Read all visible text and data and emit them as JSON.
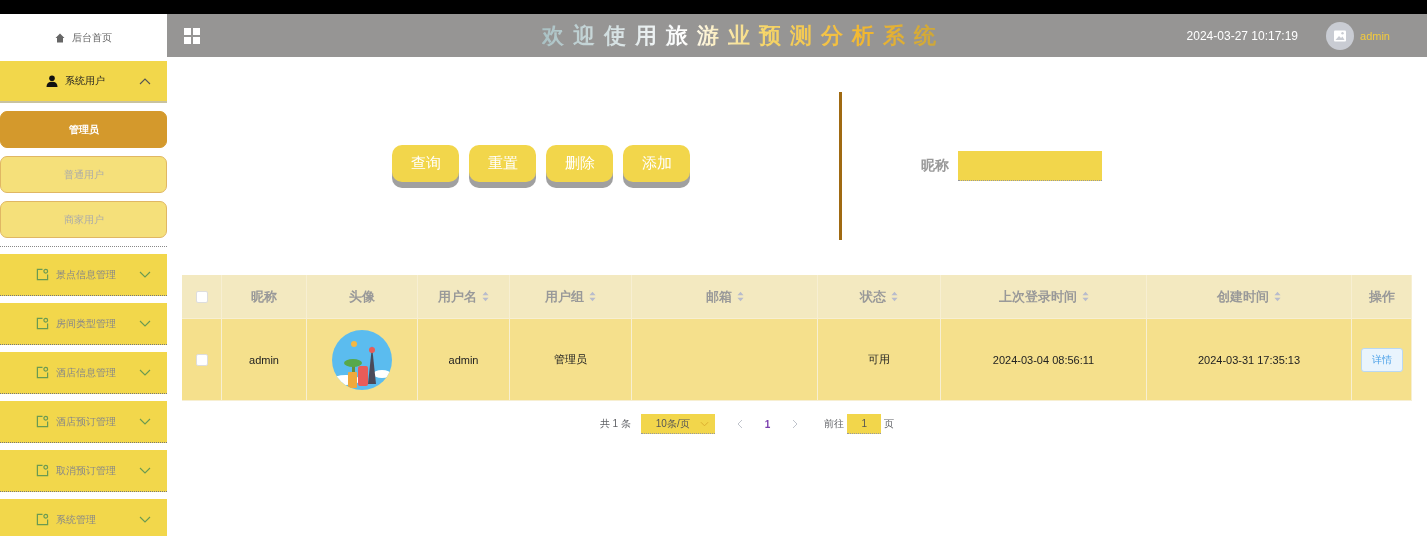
{
  "sidebar": {
    "home": {
      "label": "后台首页"
    },
    "groups": [
      {
        "label": "系统用户",
        "kind": "user",
        "expanded": true,
        "children": [
          {
            "label": "管理员",
            "selected": true
          },
          {
            "label": "普通用户",
            "selected": false
          },
          {
            "label": "商家用户",
            "selected": false
          }
        ]
      },
      {
        "label": "景点信息管理",
        "kind": "page",
        "expanded": false
      },
      {
        "label": "房间类型管理",
        "kind": "page",
        "expanded": false
      },
      {
        "label": "酒店信息管理",
        "kind": "page",
        "expanded": false
      },
      {
        "label": "酒店预订管理",
        "kind": "page",
        "expanded": false
      },
      {
        "label": "取消预订管理",
        "kind": "page",
        "expanded": false
      },
      {
        "label": "系统管理",
        "kind": "page",
        "expanded": false
      }
    ]
  },
  "header": {
    "title": "欢迎使用旅游业预测分析系统",
    "datetime": "2024-03-27 10:17:19",
    "user": "admin"
  },
  "search": {
    "buttons": [
      "查询",
      "重置",
      "删除",
      "添加"
    ],
    "field": {
      "label": "昵称"
    }
  },
  "table": {
    "select_all": {
      "checked": false
    },
    "columns": [
      {
        "label": "昵称",
        "sortable": false
      },
      {
        "label": "头像",
        "sortable": false
      },
      {
        "label": "用户名",
        "sortable": true
      },
      {
        "label": "用户组",
        "sortable": true
      },
      {
        "label": "邮箱",
        "sortable": true
      },
      {
        "label": "状态",
        "sortable": true
      },
      {
        "label": "上次登录时间",
        "sortable": true
      },
      {
        "label": "创建时间",
        "sortable": true
      },
      {
        "label": "操作",
        "sortable": false
      }
    ],
    "rows": [
      {
        "checked": false,
        "cells": [
          "admin",
          {
            "kind": "picture"
          },
          "admin",
          "管理员",
          null,
          "可用",
          "2024-03-04 08:56:11",
          "2024-03-31 17:35:13"
        ],
        "action": "详情"
      }
    ]
  },
  "pagination": {
    "total": "共 1 条",
    "page_size": "10条/页",
    "pages": [
      {
        "label": "1",
        "selected": true
      }
    ],
    "goto_label": "前往",
    "goto_value": "1",
    "goto_suffix": "页"
  }
}
